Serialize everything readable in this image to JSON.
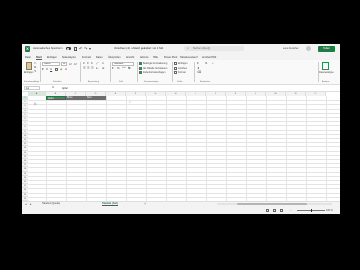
{
  "titlebar": {
    "app_icon": "excel-icon",
    "autosave_label": "Automatisches Speichern",
    "document_title": "Vorschau (v1) • Zuletzt geändert: vor 1 Std.",
    "search_placeholder": "Suchen (Alt+Q)",
    "account_name": "Lena Kerscher",
    "share_label": "Teilen"
  },
  "ribbon_tabs": [
    "Datei",
    "Start",
    "Einfügen",
    "Seitenlayout",
    "Formeln",
    "Daten",
    "Überprüfen",
    "Ansicht",
    "Add-ins",
    "Hilfe",
    "Power Pivot",
    "Tabellenentwurf",
    "Acrobat PDF"
  ],
  "active_tab": "Start",
  "ribbon": {
    "paste_label": "Einfügen",
    "font_name": "Calibri",
    "font_size": "11",
    "number_format": "Standard",
    "conditional_formatting": "Bedingte Formatierung",
    "format_as_table": "Als Tabelle formatieren",
    "cell_styles": "Zellenformatvorlagen",
    "insert_label": "Einfügen",
    "delete_label": "Löschen",
    "format_label": "Format",
    "data_analysis": "Datenanalyse",
    "groups": [
      "Zwischenablage",
      "Schriftart",
      "Ausrichtung",
      "Zahl",
      "Formatvorlagen",
      "Zellen",
      "Bearbeiten",
      "Analyse"
    ]
  },
  "formula_bar": {
    "name_box": "A1",
    "fx": "fx",
    "formula": "Apfel"
  },
  "grid": {
    "columns": [
      "A",
      "B",
      "C",
      "D",
      "E",
      "F",
      "G",
      "H",
      "I",
      "J",
      "K",
      "L",
      "M",
      "N",
      "O"
    ],
    "selected_column": "A",
    "rows": [
      "1",
      "2",
      "3",
      "4",
      "5",
      "6",
      "7",
      "8",
      "9",
      "10",
      "11",
      "12",
      "13",
      "14",
      "15",
      "16",
      "17",
      "18",
      "19",
      "20",
      "21",
      "22",
      "23",
      "24",
      "25"
    ],
    "selected_row": "1",
    "cells": {
      "A1": "Apfel",
      "B1": "Birne",
      "C1": "Kiwi"
    }
  },
  "sheets": [
    "Tabelle1 (Quelle)",
    "Tabelle1 (Ziel)"
  ],
  "active_sheet": "Tabelle1 (Ziel)",
  "status": {
    "zoom": "100 %"
  },
  "colors": {
    "accent": "#1f7a45",
    "header_fill": "#6e6e6e"
  }
}
